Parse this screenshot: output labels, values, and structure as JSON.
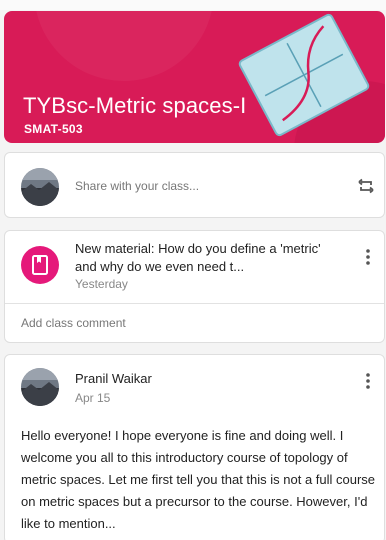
{
  "banner": {
    "title": "TYBsc-Metric spaces-I",
    "code": "SMAT-503",
    "color": "#d81b57"
  },
  "share": {
    "placeholder": "Share with your class...",
    "icon": "repost-icon"
  },
  "material": {
    "icon": "assignment-icon",
    "title": "New material: How do you define a 'metric' and why do we even need t...",
    "date": "Yesterday",
    "comment_label": "Add class comment"
  },
  "post": {
    "author": "Pranil Waikar",
    "date": "Apr 15",
    "body": "Hello everyone! I hope everyone is fine and doing well. I welcome you all to this introductory course of topology of metric spaces. Let me first tell you that this is not a full course on metric spaces but a precursor to the course. However, I'd like to mention..."
  },
  "colors": {
    "accent_pink": "#e5197a",
    "banner": "#d81b57"
  }
}
